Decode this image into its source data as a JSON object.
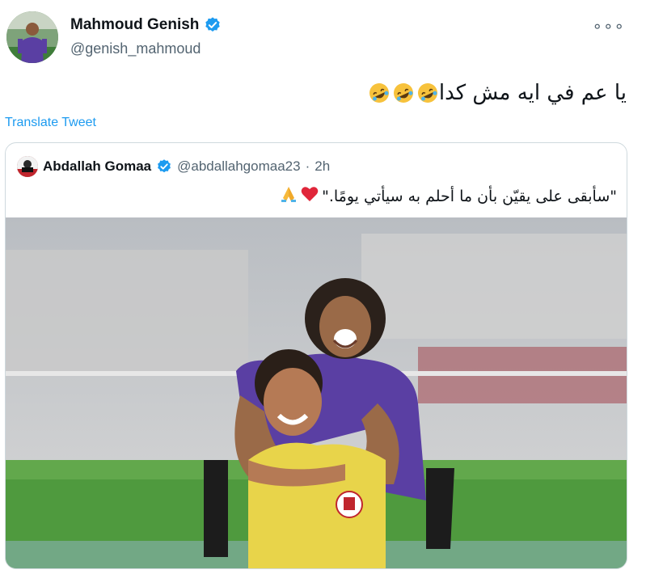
{
  "author": {
    "name": "Mahmoud Genish",
    "handle": "@genish_mahmoud"
  },
  "tweet": {
    "text": "يا عم في ايه مش كدا",
    "emojis": [
      "rolling-on-floor-laughing",
      "rolling-on-floor-laughing",
      "rolling-on-floor-laughing"
    ]
  },
  "actions": {
    "translate_label": "Translate Tweet",
    "more_label": "∘∘∘"
  },
  "quote": {
    "name": "Abdallah Gomaa",
    "handle": "@abdallahgomaa23",
    "separator": "·",
    "time": "2h",
    "text": "\"سأبقى على يقيّن بأن ما أحلم به سيأتي يومًا.\"",
    "emojis": [
      "red-heart",
      "folded-hands"
    ]
  },
  "colors": {
    "link": "#1d9bf0",
    "verified": "#1d9bf0",
    "jersey_purple": "#5a3fa3",
    "bib_yellow": "#e8d44a",
    "grass": "#4f9a3e"
  }
}
